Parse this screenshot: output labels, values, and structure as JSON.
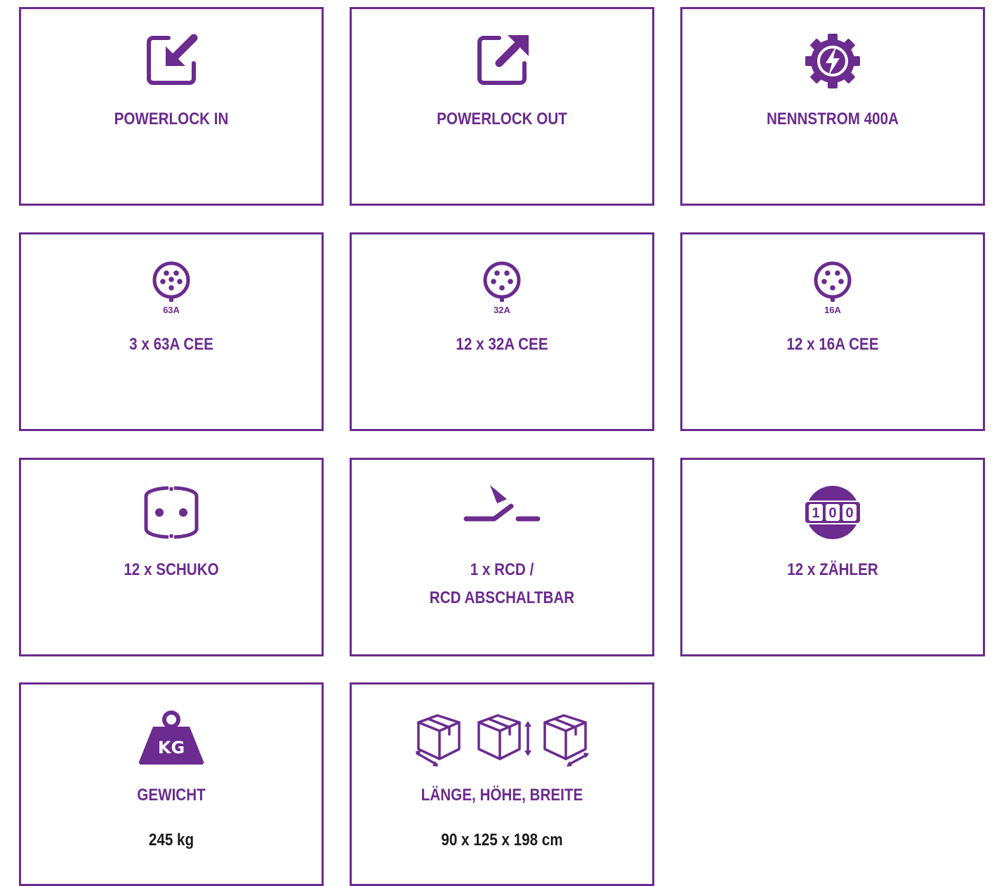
{
  "theme": {
    "accent": "#6b2b8f",
    "value_text": "#1a1a1a"
  },
  "cards": [
    {
      "icon": "import-box-icon",
      "label": "POWERLOCK IN"
    },
    {
      "icon": "export-box-icon",
      "label": "POWERLOCK OUT"
    },
    {
      "icon": "gear-lightning-icon",
      "label": "NENNSTROM 400A"
    },
    {
      "icon": "cee-socket-icon",
      "ampere": "63A",
      "label": "3 x 63A CEE"
    },
    {
      "icon": "cee-socket-icon",
      "ampere": "32A",
      "label": "12 x 32A CEE"
    },
    {
      "icon": "cee-socket-icon",
      "ampere": "16A",
      "label": "12 x 16A CEE"
    },
    {
      "icon": "schuko-socket-icon",
      "label": "12 x SCHUKO"
    },
    {
      "icon": "rcd-switch-icon",
      "label_line1": "1 x RCD /",
      "label_line2": "RCD ABSCHALTBAR"
    },
    {
      "icon": "meter-counter-icon",
      "counter": [
        "1",
        "0",
        "0"
      ],
      "label": "12 x ZÄHLER"
    },
    {
      "icon": "weight-kg-icon",
      "weight_mark": "KG",
      "label": "GEWICHT",
      "value": "245 kg"
    },
    {
      "icon": "dimension-boxes-icon",
      "label": "LÄNGE, HÖHE, BREITE",
      "value": "90 x 125 x 198 cm"
    }
  ]
}
